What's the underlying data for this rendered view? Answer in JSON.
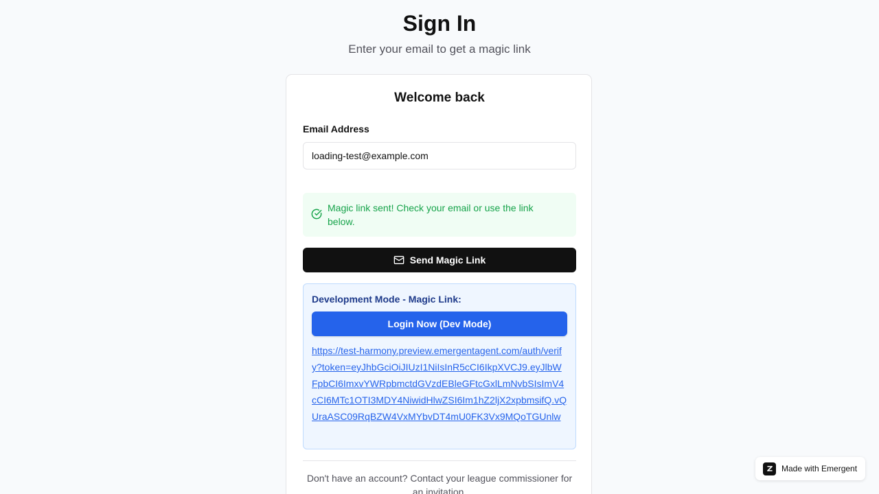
{
  "header": {
    "title": "Sign In",
    "subtitle": "Enter your email to get a magic link"
  },
  "card": {
    "title": "Welcome back",
    "email_label": "Email Address",
    "email_value": "loading-test@example.com",
    "alert_icon": "check-circle-icon",
    "alert_text": "Magic link sent! Check your email or use the link below.",
    "send_icon": "mail-icon",
    "send_label": "Send Magic Link",
    "dev": {
      "title": "Development Mode - Magic Link:",
      "login_label": "Login Now (Dev Mode)",
      "link": "https://test-harmony.preview.emergentagent.com/auth/verify?token=eyJhbGciOiJIUzI1NiIsInR5cCI6IkpXVCJ9.eyJlbWFpbCI6ImxvYWRpbmctdGVzdEBleGFtcGxlLmNvbSIsImV4cCI6MTc1OTI3MDY4NiwidHlwZSI6Im1hZ2ljX2xpbmsifQ.vQUraASC09RqBZW4VxMYbvDT4mU0FK3Vx9MQoTGUnlw"
    },
    "footer_text": "Don't have an account? Contact your league commissioner for an invitation."
  },
  "badge": {
    "icon": "emergent-logo-icon",
    "label": "Made with Emergent"
  },
  "colors": {
    "background": "#f8fafc",
    "primary_button": "#111111",
    "dev_button": "#2563eb",
    "success_text": "#16a34a",
    "success_bg": "#f0fdf4",
    "dev_bg": "#eff6ff",
    "dev_title": "#1e3a8a"
  }
}
